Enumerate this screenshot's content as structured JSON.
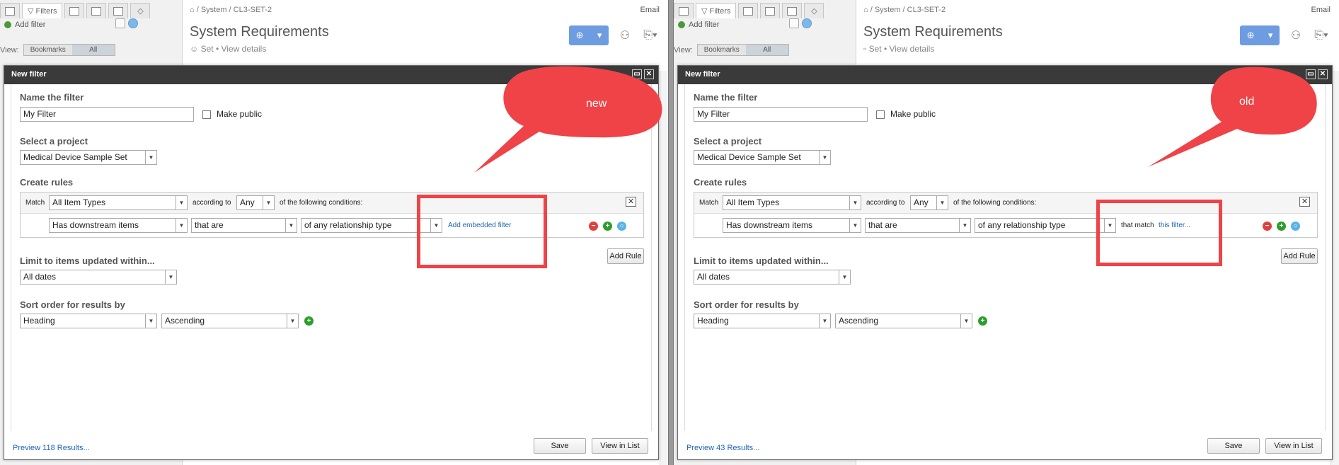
{
  "background": {
    "sidebar_tab_filters": "Filters",
    "add_filter": "Add filter",
    "view_label": "View:",
    "view_options": [
      "Bookmarks",
      "All"
    ],
    "breadcrumb": "/ System / CL3-SET-2",
    "email": "Email",
    "title": "System Requirements",
    "subtitle_set": "Set",
    "subtitle_sep": "•",
    "subtitle_link": "View details"
  },
  "modal": {
    "title": "New filter",
    "name_section": "Name the filter",
    "name_value": "My Filter",
    "make_public": "Make public",
    "project_section": "Select a project",
    "project_value": "Medical Device Sample Set",
    "rules_section": "Create rules",
    "match_label": "Match",
    "match_value": "All Item Types",
    "according_to": "according to",
    "any_value": "Any",
    "following": "of the following conditions:",
    "rule_field": "Has downstream items",
    "rule_op": "that are",
    "rule_rel": "of any relationship type",
    "add_rule": "Add Rule",
    "limit_section": "Limit to items updated within...",
    "limit_value": "All dates",
    "sort_section": "Sort order for results by",
    "sort_field": "Heading",
    "sort_dir": "Ascending",
    "save": "Save",
    "view_in_list": "View in List"
  },
  "left": {
    "embedded_link": "Add embedded filter",
    "preview": "Preview 118 Results...",
    "callout": "new"
  },
  "right": {
    "that_match": "that match",
    "this_filter": "this filter...",
    "preview": "Preview 43 Results...",
    "callout": "old"
  },
  "colors": {
    "callout": "#ef4347",
    "header": "#3a3a3a",
    "link": "#1f62b5"
  }
}
